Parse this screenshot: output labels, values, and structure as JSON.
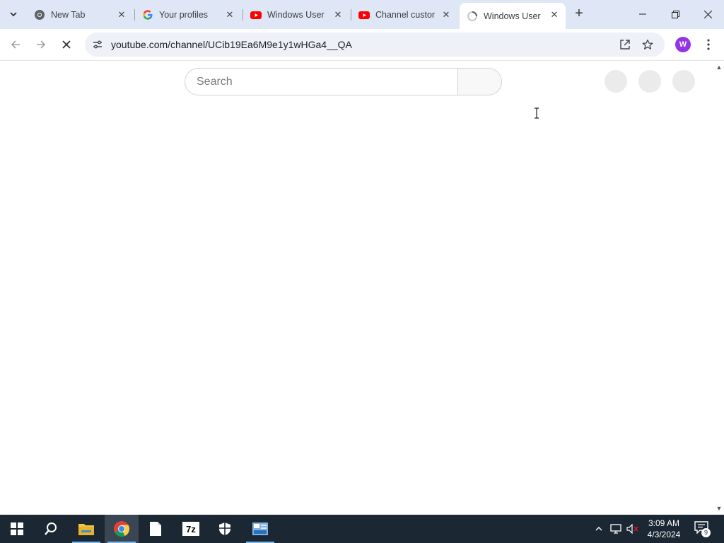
{
  "browser": {
    "tabs": [
      {
        "title": "New Tab",
        "favicon": "chrome-icon",
        "active": false
      },
      {
        "title": "Your profiles",
        "favicon": "google-icon",
        "active": false
      },
      {
        "title": "Windows User",
        "favicon": "youtube-icon",
        "active": false
      },
      {
        "title": "Channel custom",
        "favicon": "youtube-icon",
        "active": false
      },
      {
        "title": "Windows User",
        "favicon": "loading-spinner-icon",
        "active": true
      }
    ],
    "url": "youtube.com/channel/UCib19Ea6M9e1y1wHGa4__QA",
    "profile_initial": "W",
    "profile_color": "#9334e6"
  },
  "page": {
    "search_placeholder": "Search"
  },
  "taskbar": {
    "apps": [
      "start-icon",
      "search-icon",
      "file-explorer-icon",
      "chrome-icon",
      "notepad-icon",
      "7zip-icon",
      "defender-icon",
      "control-panel-icon"
    ],
    "clock_time": "3:09 AM",
    "clock_date": "4/3/2024",
    "notification_count": "9"
  }
}
